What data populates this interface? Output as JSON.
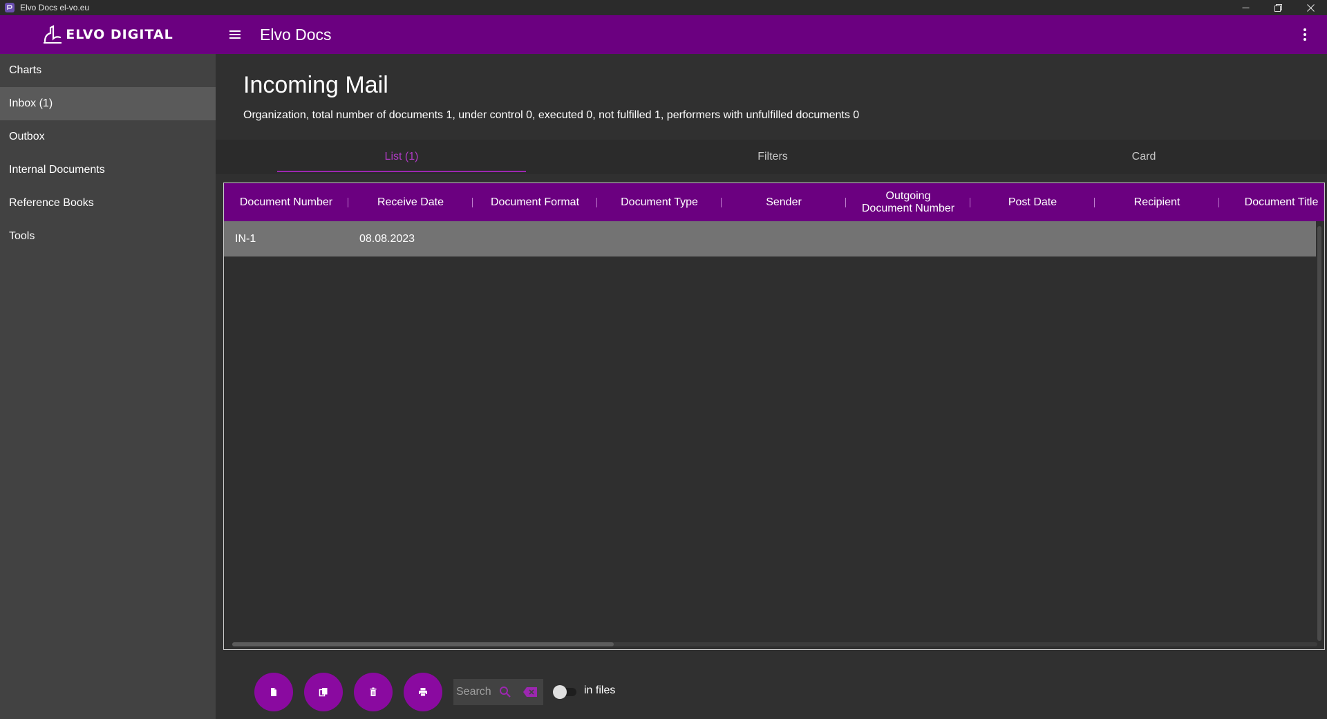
{
  "window": {
    "title": "Elvo Docs el-vo.eu",
    "controls": [
      "minimize-icon",
      "restore-icon",
      "close-icon"
    ]
  },
  "header": {
    "logo_text": "ELVO DIGITAL",
    "app_title": "Elvo Docs",
    "menu_icon": "hamburger-menu-icon",
    "more_icon": "more-vertical-icon"
  },
  "sidebar": {
    "items": [
      {
        "label": "Charts"
      },
      {
        "label": "Inbox (1)"
      },
      {
        "label": "Outbox"
      },
      {
        "label": "Internal Documents"
      },
      {
        "label": "Reference Books"
      },
      {
        "label": "Tools"
      }
    ],
    "active_index": 1
  },
  "main": {
    "title": "Incoming Mail",
    "summary": "Organization,  total number of documents 1, under control 0, executed 0, not fulfilled 1, performers with unfulfilled documents 0",
    "tabs": [
      {
        "label": "List (1)"
      },
      {
        "label": "Filters"
      },
      {
        "label": "Card"
      }
    ],
    "active_tab": 0
  },
  "table": {
    "columns": [
      "Document Number",
      "Receive Date",
      "Document Format",
      "Document Type",
      "Sender",
      "Outgoing Document Number",
      "Post Date",
      "Recipient",
      "Document Title"
    ],
    "rows": [
      [
        "IN-1",
        "08.08.2023",
        "",
        "",
        "",
        "",
        "",
        "",
        ""
      ]
    ]
  },
  "toolbar": {
    "buttons": [
      {
        "icon": "new-document-icon"
      },
      {
        "icon": "copy-document-icon"
      },
      {
        "icon": "delete-icon"
      },
      {
        "icon": "print-icon"
      }
    ],
    "search_placeholder": "Search",
    "search_icon": "search-icon",
    "clear_icon": "clear-input-icon",
    "toggle_label": "in files",
    "toggle_on": false
  },
  "colors": {
    "brand": "#6b0080",
    "accent": "#9c27b0",
    "fab": "#8a0aa0",
    "background": "#303030",
    "sidebar": "#424242"
  }
}
